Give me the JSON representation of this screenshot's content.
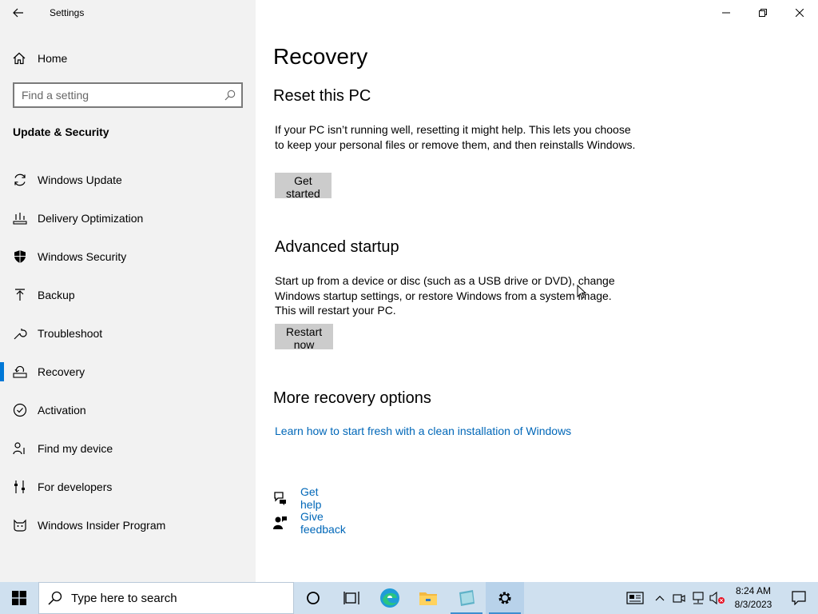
{
  "window": {
    "title": "Settings"
  },
  "sidebar": {
    "home_label": "Home",
    "search_placeholder": "Find a setting",
    "section_title": "Update & Security",
    "items": [
      {
        "label": "Windows Update",
        "icon": "sync-icon"
      },
      {
        "label": "Delivery Optimization",
        "icon": "delivery-optimization-icon"
      },
      {
        "label": "Windows Security",
        "icon": "shield-icon"
      },
      {
        "label": "Backup",
        "icon": "backup-arrow-icon"
      },
      {
        "label": "Troubleshoot",
        "icon": "wrench-icon"
      },
      {
        "label": "Recovery",
        "icon": "recovery-icon",
        "selected": true
      },
      {
        "label": "Activation",
        "icon": "check-circle-icon"
      },
      {
        "label": "Find my device",
        "icon": "person-pin-icon"
      },
      {
        "label": "For developers",
        "icon": "developer-tools-icon"
      },
      {
        "label": "Windows Insider Program",
        "icon": "insider-cat-icon"
      }
    ]
  },
  "main": {
    "page_title": "Recovery",
    "reset": {
      "heading": "Reset this PC",
      "description": "If your PC isn’t running well, resetting it might help. This lets you choose to keep your personal files or remove them, and then reinstalls Windows.",
      "button": "Get started"
    },
    "advanced": {
      "heading": "Advanced startup",
      "description": "Start up from a device or disc (such as a USB drive or DVD), change Windows startup settings, or restore Windows from a system image. This will restart your PC.",
      "button": "Restart now"
    },
    "more": {
      "heading": "More recovery options",
      "link": "Learn how to start fresh with a clean installation of Windows"
    },
    "help": {
      "get_help": "Get help",
      "feedback": "Give feedback"
    }
  },
  "taskbar": {
    "search_placeholder": "Type here to search",
    "time": "8:24 AM",
    "date": "8/3/2023",
    "accent": "#0078d7"
  }
}
